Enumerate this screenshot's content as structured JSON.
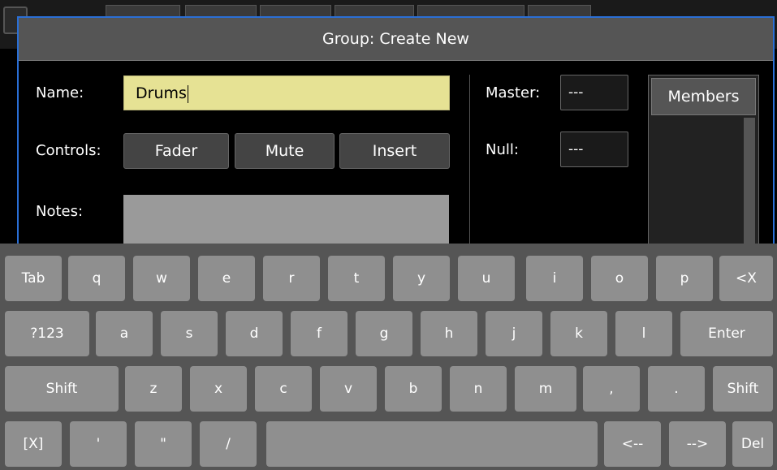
{
  "dialog": {
    "title": "Group: Create New",
    "name_label": "Name:",
    "name_value": "Drums",
    "controls_label": "Controls:",
    "controls": [
      "Fader",
      "Mute",
      "Insert"
    ],
    "notes_label": "Notes:",
    "master_label": "Master:",
    "master_value": "---",
    "null_label": "Null:",
    "null_value": "---",
    "members_header": "Members"
  },
  "keyboard": {
    "row1": [
      "Tab",
      "q",
      "w",
      "e",
      "r",
      "t",
      "y",
      "u",
      "i",
      "o",
      "p",
      "<X"
    ],
    "row2": [
      "?123",
      "a",
      "s",
      "d",
      "f",
      "g",
      "h",
      "j",
      "k",
      "l",
      "Enter"
    ],
    "row3": [
      "Shift",
      "z",
      "x",
      "c",
      "v",
      "b",
      "n",
      "m",
      ",",
      ".",
      "Shift"
    ],
    "row4": [
      "[X]",
      "'",
      "\"",
      "/",
      "",
      "<--",
      "-->",
      "Del"
    ]
  },
  "colors": {
    "accent_border": "#2a6fd6",
    "name_field": "#e6e294",
    "key": "#8f8f8f",
    "keyboard_bg": "#555555"
  }
}
